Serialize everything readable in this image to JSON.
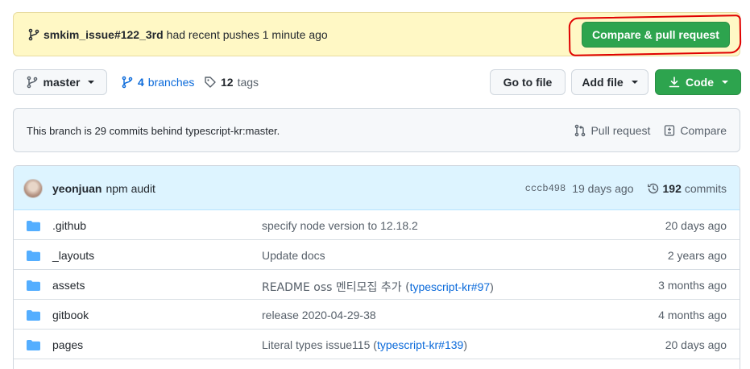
{
  "banner": {
    "branch": "smkim_issue#122_3rd",
    "suffix": "had recent pushes 1 minute ago",
    "button_label": "Compare & pull request"
  },
  "toolbar": {
    "branch_label": "master",
    "branches_count": "4",
    "branches_label": "branches",
    "tags_count": "12",
    "tags_label": "tags",
    "goto_file": "Go to file",
    "add_file": "Add file",
    "code": "Code"
  },
  "behind": {
    "text": "This branch is 29 commits behind typescript-kr:master.",
    "pull_request": "Pull request",
    "compare": "Compare"
  },
  "latest_commit": {
    "author": "yeonjuan",
    "message": "npm audit",
    "sha": "cccb498",
    "age": "19 days ago",
    "commits_count": "192",
    "commits_label": "commits"
  },
  "files": [
    {
      "name": ".github",
      "message": "specify node version to 12.18.2",
      "link": "",
      "tail": "",
      "age": "20 days ago"
    },
    {
      "name": "_layouts",
      "message": "Update docs",
      "link": "",
      "tail": "",
      "age": "2 years ago"
    },
    {
      "name": "assets",
      "message": "README oss 멘티모집 추가 (",
      "link": "typescript-kr#97",
      "tail": ")",
      "age": "3 months ago"
    },
    {
      "name": "gitbook",
      "message": "release 2020-04-29-38",
      "link": "",
      "tail": "",
      "age": "4 months ago"
    },
    {
      "name": "pages",
      "message": "Literal types issue115 (",
      "link": "typescript-kr#139",
      "tail": ")",
      "age": "20 days ago"
    }
  ],
  "colors": {
    "accent_green": "#2da44e",
    "link_blue": "#0969da",
    "banner_bg": "#fff8c5",
    "highlight_red": "#e00000"
  }
}
